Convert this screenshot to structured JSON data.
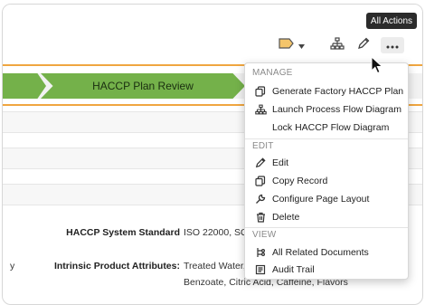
{
  "toolbar": {
    "actions_tooltip": "All Actions",
    "icons": [
      "state-flag-icon",
      "hierarchy-icon",
      "pencil-icon",
      "more-icon"
    ]
  },
  "stage": {
    "current_label": "HACCP Plan Review"
  },
  "fields": [
    {
      "label": "HACCP System Standard",
      "value": "ISO 22000, SQ"
    },
    {
      "label": "Intrinsic Product Attributes:",
      "value": "Treated Water,",
      "value2": "Benzoate, Citric Acid, Caffeine, Flavors"
    }
  ],
  "left_fragment": "y",
  "menu": {
    "sections": [
      {
        "title": "MANAGE",
        "items": [
          {
            "label": "Generate Factory HACCP Plan",
            "icon": "copy-icon"
          },
          {
            "label": "Launch Process Flow Diagram",
            "icon": "hierarchy-icon"
          },
          {
            "label": "Lock HACCP Flow Diagram",
            "icon": ""
          }
        ]
      },
      {
        "title": "EDIT",
        "items": [
          {
            "label": "Edit",
            "icon": "pencil-icon"
          },
          {
            "label": "Copy Record",
            "icon": "copy-icon"
          },
          {
            "label": "Configure Page Layout",
            "icon": "wrench-icon"
          },
          {
            "label": "Delete",
            "icon": "trash-icon"
          }
        ]
      },
      {
        "title": "VIEW",
        "items": [
          {
            "label": "All Related Documents",
            "icon": "related-icon"
          },
          {
            "label": "Audit Trail",
            "icon": "audit-icon"
          }
        ]
      }
    ]
  }
}
